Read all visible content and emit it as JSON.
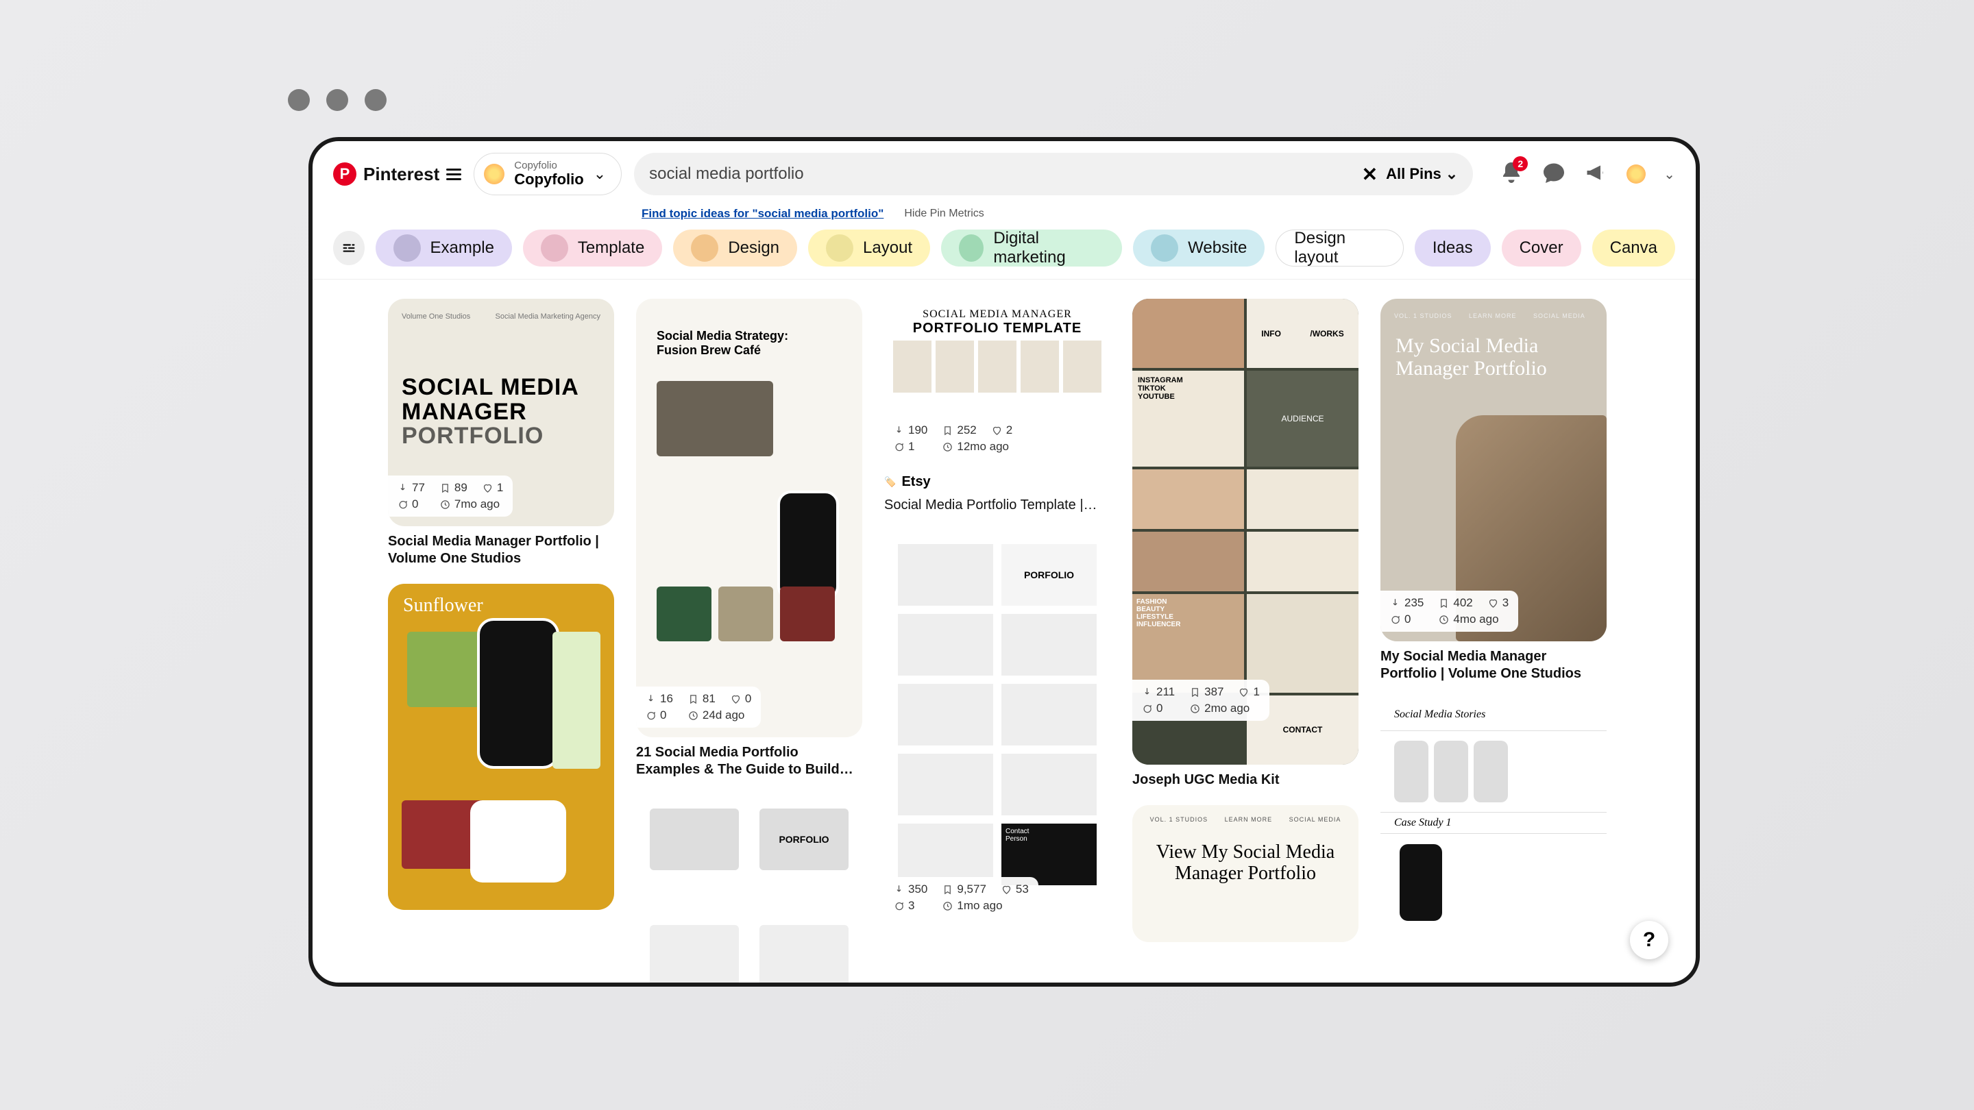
{
  "header": {
    "brand": "Pinterest",
    "account": {
      "sub": "Copyfolio",
      "main": "Copyfolio"
    },
    "search_value": "social media portfolio",
    "pins_filter": "All Pins",
    "notifications_badge": "2"
  },
  "sublinks": {
    "topic_ideas": "Find topic ideas for \"social media portfolio\"",
    "hide_metrics": "Hide Pin Metrics"
  },
  "chips": [
    {
      "label": "Example"
    },
    {
      "label": "Template"
    },
    {
      "label": "Design"
    },
    {
      "label": "Layout"
    },
    {
      "label": "Digital marketing"
    },
    {
      "label": "Website"
    },
    {
      "label": "Design layout"
    },
    {
      "label": "Ideas"
    },
    {
      "label": "Cover"
    },
    {
      "label": "Canva"
    }
  ],
  "pins": {
    "p1": {
      "heading_1": "SOCIAL MEDIA",
      "heading_2": "MANAGER",
      "heading_3": "PORTFOLIO",
      "caption": "Social Media Manager Portfolio | Volume One Studios",
      "stats": {
        "pin": "77",
        "save": "89",
        "like": "1",
        "comment": "0",
        "time": "7mo ago"
      }
    },
    "p2": {
      "title": "Sunflower"
    },
    "p3": {
      "title": "Social Media Strategy:\nFusion Brew Café",
      "caption": "21 Social Media Portfolio Examples & The Guide to Build…",
      "stats": {
        "pin": "16",
        "save": "81",
        "like": "0",
        "comment": "0",
        "time": "24d ago"
      }
    },
    "p4": {
      "label_porfolio": "PORFOLIO"
    },
    "p5": {
      "title_line1": "SOCIAL MEDIA MANAGER",
      "title_line2": "PORTFOLIO TEMPLATE",
      "src": "Etsy",
      "caption": "Social Media Portfolio Template |…",
      "stats": {
        "pin": "190",
        "save": "252",
        "like": "2",
        "comment": "1",
        "time": "12mo ago"
      }
    },
    "p6": {
      "label_porfolio": "PORFOLIO",
      "stats": {
        "pin": "350",
        "save": "9,577",
        "like": "53",
        "comment": "3",
        "time": "1mo ago"
      }
    },
    "p7": {
      "labels": {
        "info": "INFO",
        "works": "/WORKS",
        "aud": "AUDIENCE",
        "platforms": "INSTAGRAM\nTIKTOK\nYOUTUBE",
        "fash": "FASHION\nBEAUTY\nLIFESTYLE\nINFLUENCER",
        "contact": "CONTACT"
      },
      "caption": "Joseph UGC Media Kit",
      "stats": {
        "pin": "211",
        "save": "387",
        "like": "1",
        "comment": "0",
        "time": "2mo ago"
      }
    },
    "p8": {
      "title": "View My Social Media\nManager Portfolio",
      "crumbs": "VOL. 1 STUDIOS       LEARN MORE       SOCIAL MEDIA"
    },
    "p9": {
      "crumbs": "VOL. 1 STUDIOS       LEARN MORE       SOCIAL MEDIA",
      "title": "My Social Media\nManager Portfolio",
      "caption": "My Social Media Manager Portfolio | Volume One Studios",
      "stats": {
        "pin": "235",
        "save": "402",
        "like": "3",
        "comment": "0",
        "time": "4mo ago"
      }
    },
    "p10": {
      "l1": "Social Media Stories",
      "l2": "Case Study 1"
    }
  },
  "help": "?"
}
